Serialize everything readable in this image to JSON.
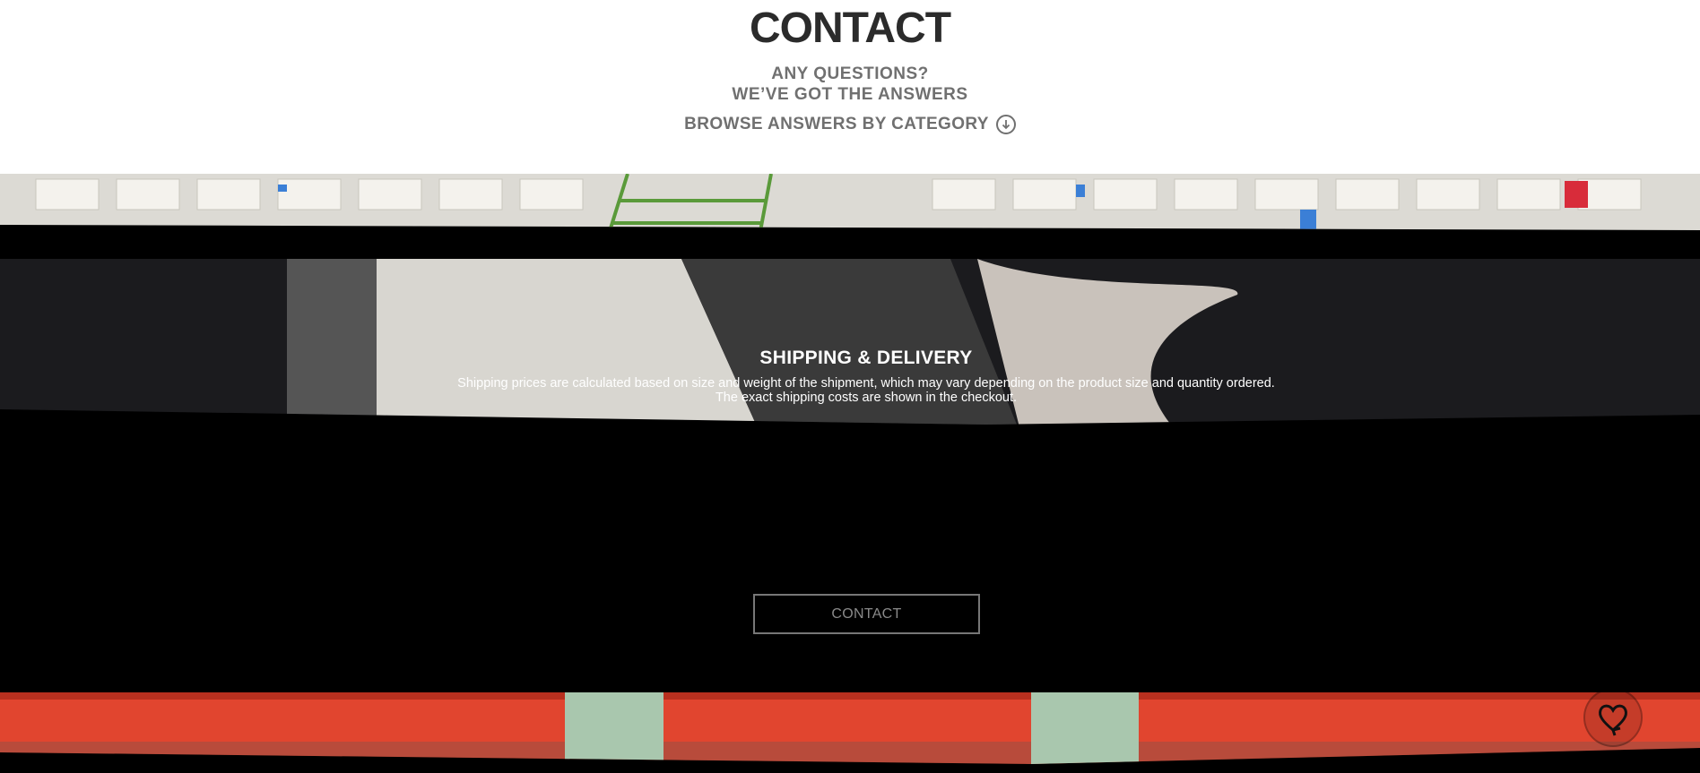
{
  "page": {
    "title": "CONTACT",
    "subtitle_line1": "ANY QUESTIONS?",
    "subtitle_line2": "WE’VE GOT THE ANSWERS",
    "browse_label": "BROWSE ANSWERS BY CATEGORY"
  },
  "section": {
    "heading": "SHIPPING & DELIVERY",
    "text_line1": "Shipping prices are calculated based on size and weight of the shipment, which may vary depending on the product size and quantity ordered.",
    "text_line2": "The exact shipping costs are shown in the checkout.",
    "button_label": "CONTACT"
  },
  "icons": {
    "browse": "arrow-down-circle-icon",
    "fab": "heart-cycle-icon"
  },
  "colors": {
    "text_dark": "#2b2b2b",
    "text_grey": "#707070",
    "band_red": "#e1452f",
    "background_dark": "#000000"
  }
}
